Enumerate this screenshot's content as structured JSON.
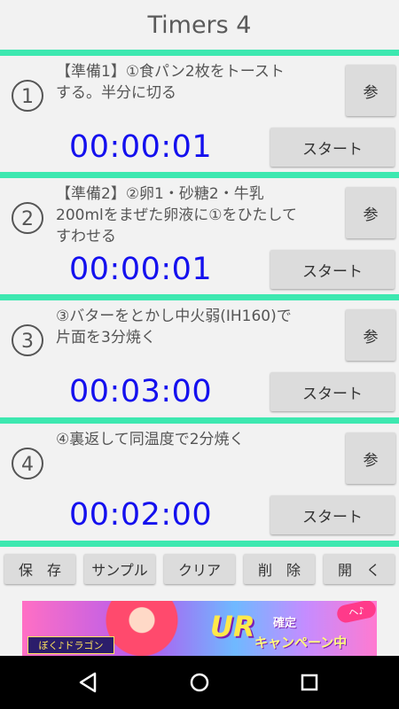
{
  "app": {
    "title": "Timers 4"
  },
  "timers": [
    {
      "number_icon": "circled-1-icon",
      "task": "【準備1】①食パン2枚をトースト\nする。半分に切る",
      "ref_label": "参",
      "time": "00:00:01",
      "start_label": "スタート"
    },
    {
      "number_icon": "circled-2-icon",
      "task": "【準備2】②卵1・砂糖2・牛乳\n200mlをまぜた卵液に①をひたして\nすわせる",
      "ref_label": "参",
      "time": "00:00:01",
      "start_label": "スタート"
    },
    {
      "number_icon": "circled-3-icon",
      "task": "③バターをとかし中火弱(IH160)で\n片面を3分焼く",
      "ref_label": "参",
      "time": "00:03:00",
      "start_label": "スタート"
    },
    {
      "number_icon": "circled-4-icon",
      "task": "④裏返して同温度で2分焼く",
      "ref_label": "参",
      "time": "00:02:00",
      "start_label": "スタート"
    }
  ],
  "toolbar": {
    "save_label": "保　存",
    "sample_label": "サンプル",
    "clear_label": "クリア",
    "delete_label": "削　除",
    "open_label": "開　く"
  },
  "banner": {
    "logo_text": "ぼく♪ドラゴン",
    "headline": "UR",
    "confirm_text": "確定",
    "campaign_text": "キャンペーン中",
    "badge_text": "ヘ♪"
  },
  "colors": {
    "separator": "#3de8b0",
    "time_text": "#1410ee",
    "button_bg": "#dcdcdc"
  },
  "navigation": {
    "back_icon": "back-triangle-icon",
    "home_icon": "home-circle-icon",
    "recents_icon": "recents-square-icon"
  }
}
